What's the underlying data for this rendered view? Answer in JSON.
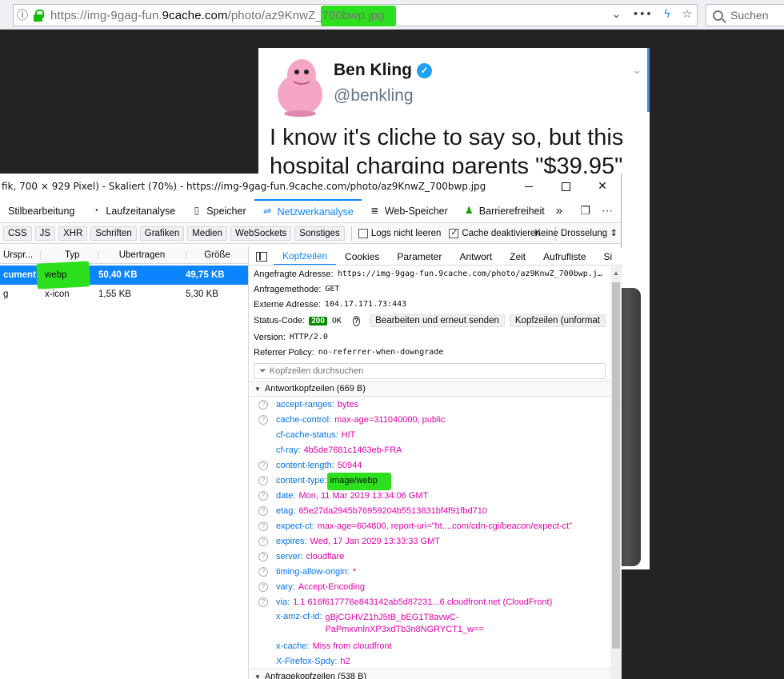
{
  "browser": {
    "url_prefix": "https://img-9gag-fun.",
    "url_domain": "9cache.com",
    "url_path": "/photo/az9KnwZ_700bwp.jpg",
    "search_placeholder": "Suchen",
    "menu_dots": "•••"
  },
  "tweet": {
    "name": "Ben Kling",
    "handle": "@benkling",
    "text": "I know it's cliche to say so, but this hospital charging parents \"$39.95\""
  },
  "devtools": {
    "title": "fik, 700 × 929 Pixel) - Skaliert (70%) - https://img-9gag-fun.9cache.com/photo/az9KnwZ_700bwp.jpg",
    "tabs": [
      {
        "label": "Stilbearbeitung",
        "icon": "style-editor-icon"
      },
      {
        "label": "Laufzeitanalyse",
        "icon": "performance-icon"
      },
      {
        "label": "Speicher",
        "icon": "memory-icon"
      },
      {
        "label": "Netzwerkanalyse",
        "icon": "network-icon"
      },
      {
        "label": "Web-Speicher",
        "icon": "storage-icon"
      },
      {
        "label": "Barrierefreiheit",
        "icon": "accessibility-icon"
      }
    ],
    "filters": [
      "CSS",
      "JS",
      "XHR",
      "Schriften",
      "Grafiken",
      "Medien",
      "WebSockets",
      "Sonstiges"
    ],
    "persist_logs": "Logs nicht leeren",
    "disable_cache": "Cache deaktivieren",
    "throttling": "Keine Drosselung",
    "columns": {
      "origin": "Urspr...",
      "type": "Typ",
      "transferred": "Übertragen",
      "size": "Größe"
    },
    "requests": [
      {
        "origin": "cument",
        "type": "webp",
        "transferred": "50,40 KB",
        "size": "49,75 KB"
      },
      {
        "origin": "g",
        "type": "x-icon",
        "transferred": "1,55 KB",
        "size": "5,30 KB"
      }
    ],
    "detail_tabs": [
      "Kopfzeilen",
      "Cookies",
      "Parameter",
      "Antwort",
      "Zeit",
      "Aufrufliste",
      "Si"
    ],
    "summary": {
      "request_url_label": "Angefragte Adresse:",
      "request_url": "https://img-9gag-fun.9cache.com/photo/az9KnwZ_700bwp.j…",
      "method_label": "Anfragemethode:",
      "method": "GET",
      "remote_label": "Externe Adresse:",
      "remote": "104.17.171.73:443",
      "status_label": "Status-Code:",
      "status_code": "200",
      "status_text": "OK",
      "edit_resend": "Bearbeiten und erneut senden",
      "raw_headers": "Kopfzeilen (unformat",
      "version_label": "Version:",
      "version": "HTTP/2.0",
      "referrer_label": "Referrer Policy:",
      "referrer": "no-referrer-when-downgrade",
      "filter_placeholder": "Kopfzeilen durchsuchen"
    },
    "response_section": "Antwortkopfzeilen (669 B)",
    "response_headers": [
      {
        "k": "accept-ranges:",
        "v": "bytes",
        "q": true
      },
      {
        "k": "cache-control:",
        "v": "max-age=311040000, public",
        "q": true
      },
      {
        "k": "cf-cache-status:",
        "v": "HIT",
        "q": false
      },
      {
        "k": "cf-ray:",
        "v": "4b5de7681c1463eb-FRA",
        "q": false
      },
      {
        "k": "content-length:",
        "v": "50944",
        "q": true
      },
      {
        "k": "content-type:",
        "v": "image/webp",
        "q": true
      },
      {
        "k": "date:",
        "v": "Mon, 11 Mar 2019 13:34:06 GMT",
        "q": true
      },
      {
        "k": "etag:",
        "v": "65e27da2945b76959204b5513831bf4f91fbd710",
        "q": true
      },
      {
        "k": "expect-ct:",
        "v": "max-age=604800, report-uri=\"ht....com/cdn-cgi/beacon/expect-ct\"",
        "q": true
      },
      {
        "k": "expires:",
        "v": "Wed, 17 Jan 2029 13:33:33 GMT",
        "q": true
      },
      {
        "k": "server:",
        "v": "cloudflare",
        "q": true
      },
      {
        "k": "timing-allow-origin:",
        "v": "*",
        "q": true
      },
      {
        "k": "vary:",
        "v": "Accept-Encoding",
        "q": true
      },
      {
        "k": "via:",
        "v": "1.1 616f617776e843142ab5d87231...6.cloudfront.net (CloudFront)",
        "q": true
      },
      {
        "k": "x-amz-cf-id:",
        "v": "gBjCGHVZ1hJ5tB_bEG1T8avwC-PaPmxvnlnXP3xdTb3n8NGRYCT1_w==",
        "q": false
      },
      {
        "k": "x-cache:",
        "v": "Miss from cloudfront",
        "q": false
      },
      {
        "k": "X-Firefox-Spdy:",
        "v": "h2",
        "q": false
      }
    ],
    "request_section": "Anfragekopfzeilen (538 B)"
  }
}
